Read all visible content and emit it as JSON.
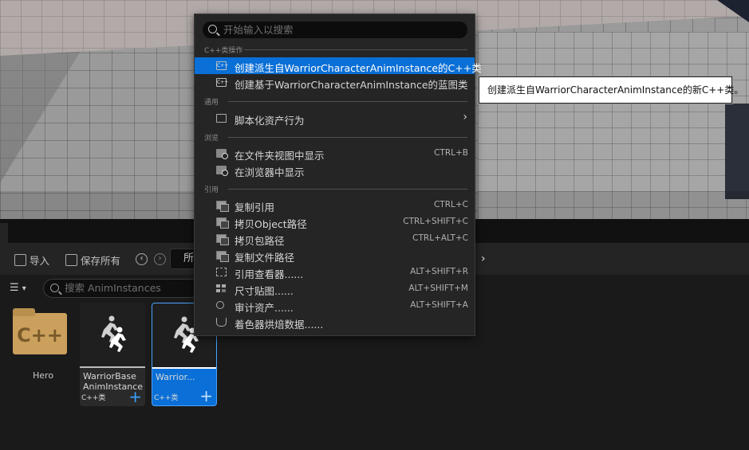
{
  "menu": {
    "search_placeholder": "开始输入以搜索",
    "sections": {
      "cpp": "C++类操作",
      "common": "通用",
      "browse": "浏览",
      "reference": "引用"
    },
    "items": [
      {
        "label": "创建派生自WarriorCharacterAnimInstance的C++类",
        "shortcut": "",
        "icon": "cpp-class-icon",
        "highlighted": true
      },
      {
        "label": "创建基于WarriorCharacterAnimInstance的蓝图类",
        "shortcut": "",
        "icon": "blueprint-class-icon"
      },
      {
        "label": "脚本化资产行为",
        "shortcut": "",
        "icon": "script-icon",
        "submenu": true
      },
      {
        "label": "在文件夹视图中显示",
        "shortcut": "CTRL+B",
        "icon": "folder-view-icon"
      },
      {
        "label": "在浏览器中显示",
        "shortcut": "",
        "icon": "browser-icon"
      },
      {
        "label": "复制引用",
        "shortcut": "CTRL+C",
        "icon": "copy-reference-icon"
      },
      {
        "label": "拷贝Object路径",
        "shortcut": "CTRL+SHIFT+C",
        "icon": "copy-object-path-icon"
      },
      {
        "label": "拷贝包路径",
        "shortcut": "CTRL+ALT+C",
        "icon": "copy-package-path-icon"
      },
      {
        "label": "复制文件路径",
        "shortcut": "",
        "icon": "copy-file-path-icon"
      },
      {
        "label": "引用查看器......",
        "shortcut": "ALT+SHIFT+R",
        "icon": "reference-viewer-icon"
      },
      {
        "label": "尺寸贴图......",
        "shortcut": "ALT+SHIFT+M",
        "icon": "size-map-icon"
      },
      {
        "label": "审计资产......",
        "shortcut": "ALT+SHIFT+A",
        "icon": "audit-icon"
      },
      {
        "label": "着色器烘焙数据......",
        "shortcut": "",
        "icon": "shader-cook-icon"
      }
    ]
  },
  "tooltip": {
    "text": "创建派生自WarriorCharacterAnimInstance的新C++类。"
  },
  "toolbar": {
    "import_label": "导入",
    "save_all_label": "保存所有",
    "path_text": "所"
  },
  "filter": {
    "search_placeholder": "搜索 AnimInstances"
  },
  "assets": {
    "folder": {
      "name": "Hero",
      "icon_text": "C++"
    },
    "tiles": [
      {
        "name_line1": "WarriorBase",
        "name_line2": "AnimInstance",
        "type": "C++类",
        "selected": false
      },
      {
        "name_line1": "Warrior...",
        "name_line2": "",
        "type": "C++类",
        "selected": true
      }
    ]
  },
  "colors": {
    "highlight": "#0a6fd6",
    "menu_bg": "#252526",
    "folder": "#caa05c",
    "plus": "#3aa0ff"
  }
}
